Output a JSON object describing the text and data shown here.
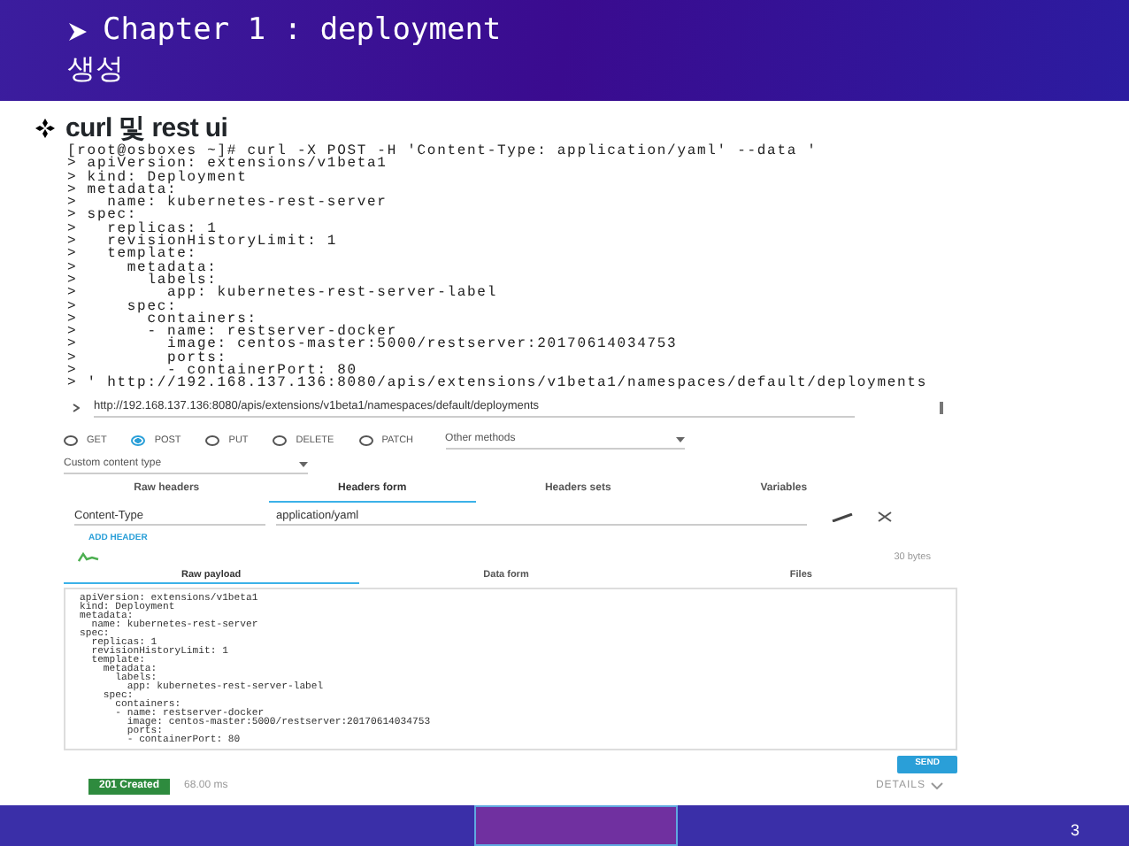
{
  "slide": {
    "title_lines": [
      "Chapter 1 : deployment",
      "생성"
    ],
    "bullet": "curl 및 rest ui",
    "page_number": "3"
  },
  "terminal_lines": [
    "[root@osboxes ~]# curl -X POST -H 'Content-Type: application/yaml' --data '",
    "> apiVersion: extensions/v1beta1",
    "> kind: Deployment",
    "> metadata:",
    ">   name: kubernetes-rest-server",
    "> spec:",
    ">   replicas: 1",
    ">   revisionHistoryLimit: 1",
    ">   template:",
    ">     metadata:",
    ">       labels:",
    ">         app: kubernetes-rest-server-label",
    ">     spec:",
    ">       containers:",
    ">       - name: restserver-docker",
    ">         image: centos-master:5000/restserver:20170614034753",
    ">         ports:",
    ">         - containerPort: 80",
    "> ' http://192.168.137.136:8080/apis/extensions/v1beta1/namespaces/default/deployments"
  ],
  "rest_client": {
    "url": "http://192.168.137.136:8080/apis/extensions/v1beta1/namespaces/default/deployments",
    "methods": [
      {
        "label": "GET",
        "selected": false
      },
      {
        "label": "POST",
        "selected": true
      },
      {
        "label": "PUT",
        "selected": false
      },
      {
        "label": "DELETE",
        "selected": false
      },
      {
        "label": "PATCH",
        "selected": false
      }
    ],
    "other_methods": "Other methods",
    "content_type": "Custom content type",
    "header_tabs": [
      {
        "label": "Raw headers",
        "selected": false
      },
      {
        "label": "Headers form",
        "selected": true
      },
      {
        "label": "Headers sets",
        "selected": false
      },
      {
        "label": "Variables",
        "selected": false
      }
    ],
    "headers": [
      {
        "name": "Content-Type",
        "value": "application/yaml"
      }
    ],
    "add_header": "ADD HEADER",
    "size": "30 bytes",
    "payload_tabs": [
      {
        "label": "Raw payload",
        "selected": true
      },
      {
        "label": "Data form",
        "selected": false
      },
      {
        "label": "Files",
        "selected": false
      }
    ],
    "payload_lines": [
      "apiVersion: extensions/v1beta1",
      "kind: Deployment",
      "metadata:",
      "  name: kubernetes-rest-server",
      "spec:",
      "  replicas: 1",
      "  revisionHistoryLimit: 1",
      "  template:",
      "    metadata:",
      "      labels:",
      "        app: kubernetes-rest-server-label",
      "    spec:",
      "      containers:",
      "      - name: restserver-docker",
      "        image: centos-master:5000/restserver:20170614034753",
      "        ports:",
      "        - containerPort: 80"
    ],
    "send": "SEND",
    "status": "201 Created",
    "time": "68.00 ms",
    "details": "DETAILS"
  }
}
